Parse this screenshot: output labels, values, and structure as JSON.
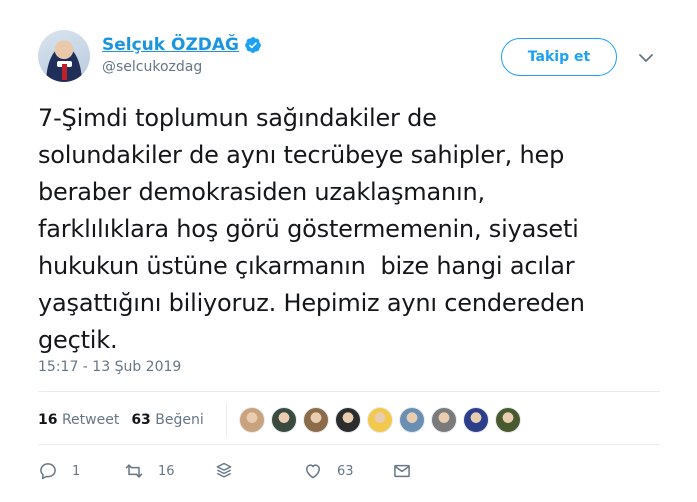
{
  "author": {
    "display_name": "Selçuk ÖZDAĞ",
    "username": "@selcukozdag",
    "verified": true
  },
  "follow_button": {
    "label": "Takip et"
  },
  "tweet": {
    "text": "7-Şimdi toplumun sağındakiler de\nsolundakiler de aynı tecrübeye sahipler, hep\nberaber demokrasiden uzaklaşmanın,\nfarklılıklara hoş görü göstermemenin, siyaseti\nhukukun üstüne çıkarmanın  bize hangi acılar\nyaşattığını biliyoruz. Hepimiz aynı cendereden\ngeçtik.",
    "timestamp": "15:17 - 13 Şub 2019"
  },
  "stats": {
    "retweets_count": "16",
    "retweets_label": "Retweet",
    "likes_count": "63",
    "likes_label": "Beğeni"
  },
  "likers": [
    {
      "color": "#c9a27e"
    },
    {
      "color": "#3b4a3f"
    },
    {
      "color": "#8b6b4a"
    },
    {
      "color": "#2d2d2d"
    },
    {
      "color": "#f2c94c"
    },
    {
      "color": "#6b8fb3"
    },
    {
      "color": "#7a7a7a"
    },
    {
      "color": "#2c3e8c"
    },
    {
      "color": "#4a5a2f"
    }
  ],
  "actions": {
    "reply_count": "1",
    "retweet_count": "16",
    "like_count": "63"
  },
  "colors": {
    "brand_blue": "#1da1f2",
    "name_blue": "#1b95e0",
    "muted": "#657786",
    "border": "#e6ecf0"
  }
}
